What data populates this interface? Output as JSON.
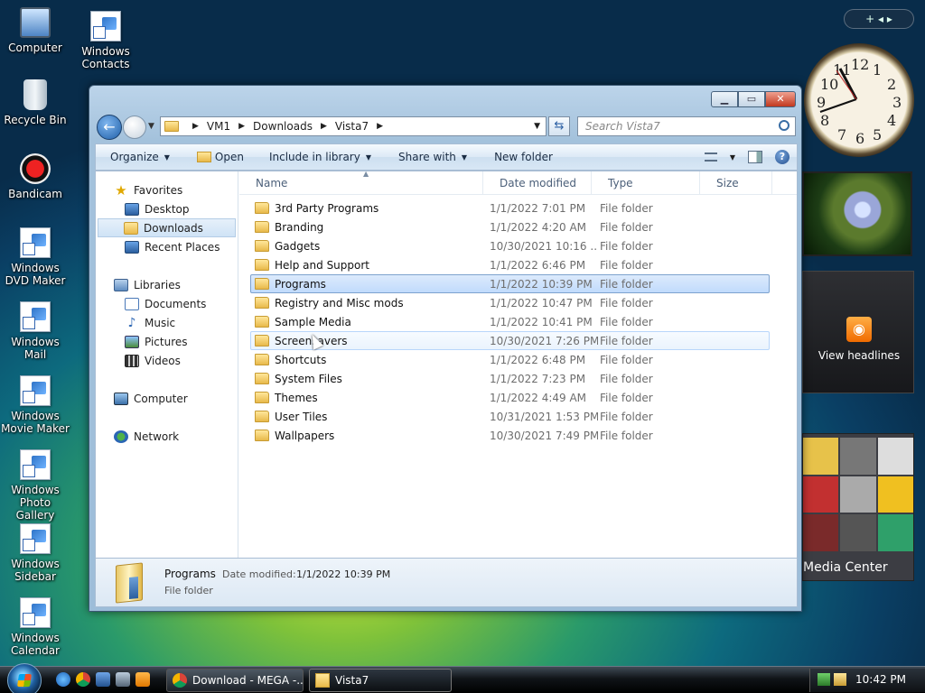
{
  "desktop_icons": [
    {
      "label": "Computer"
    },
    {
      "label": "Windows Contacts"
    },
    {
      "label": "Recycle Bin"
    },
    {
      "label": "Bandicam"
    },
    {
      "label": "Windows DVD Maker"
    },
    {
      "label": "Windows Mail"
    },
    {
      "label": "Windows Movie Maker"
    },
    {
      "label": "Windows Photo Gallery"
    },
    {
      "label": "Windows Sidebar"
    },
    {
      "label": "Windows Calendar"
    }
  ],
  "sidebar": {
    "controls": "+ ◂ ▸",
    "clock_numbers": [
      "12",
      "1",
      "2",
      "3",
      "4",
      "5",
      "6",
      "7",
      "8",
      "9",
      "10",
      "11"
    ],
    "feed_label": "View headlines",
    "media_center_label": "Media Center"
  },
  "explorer": {
    "breadcrumb": [
      "VM1",
      "Downloads",
      "Vista7"
    ],
    "search_placeholder": "Search Vista7",
    "toolbar": {
      "organize": "Organize",
      "open": "Open",
      "include_in_library": "Include in library",
      "share_with": "Share with",
      "new_folder": "New folder",
      "help": "?"
    },
    "nav": {
      "favorites": "Favorites",
      "desktop": "Desktop",
      "downloads": "Downloads",
      "recent_places": "Recent Places",
      "libraries": "Libraries",
      "documents": "Documents",
      "music": "Music",
      "pictures": "Pictures",
      "videos": "Videos",
      "computer": "Computer",
      "network": "Network"
    },
    "columns": {
      "name": "Name",
      "date_modified": "Date modified",
      "type": "Type",
      "size": "Size"
    },
    "files": [
      {
        "name": "3rd Party Programs",
        "date": "1/1/2022 7:01 PM",
        "type": "File folder"
      },
      {
        "name": "Branding",
        "date": "1/1/2022 4:20 AM",
        "type": "File folder"
      },
      {
        "name": "Gadgets",
        "date": "10/30/2021 10:16 ...",
        "type": "File folder"
      },
      {
        "name": "Help and Support",
        "date": "1/1/2022 6:46 PM",
        "type": "File folder"
      },
      {
        "name": "Programs",
        "date": "1/1/2022 10:39 PM",
        "type": "File folder"
      },
      {
        "name": "Registry and Misc mods",
        "date": "1/1/2022 10:47 PM",
        "type": "File folder"
      },
      {
        "name": "Sample Media",
        "date": "1/1/2022 10:41 PM",
        "type": "File folder"
      },
      {
        "name": "Screensavers",
        "date": "10/30/2021 7:26 PM",
        "type": "File folder"
      },
      {
        "name": "Shortcuts",
        "date": "1/1/2022 6:48 PM",
        "type": "File folder"
      },
      {
        "name": "System Files",
        "date": "1/1/2022 7:23 PM",
        "type": "File folder"
      },
      {
        "name": "Themes",
        "date": "1/1/2022 4:49 AM",
        "type": "File folder"
      },
      {
        "name": "User Tiles",
        "date": "10/31/2021 1:53 PM",
        "type": "File folder"
      },
      {
        "name": "Wallpapers",
        "date": "10/30/2021 7:49 PM",
        "type": "File folder"
      }
    ],
    "selected_file": "Programs",
    "hovered_file": "Screensavers",
    "details": {
      "name": "Programs",
      "modified_label": "Date modified:",
      "modified_value": "1/1/2022 10:39 PM",
      "type": "File folder"
    }
  },
  "taskbar": {
    "chrome_task": "Download - MEGA -...",
    "explorer_task": "Vista7",
    "clock": "10:42 PM"
  }
}
